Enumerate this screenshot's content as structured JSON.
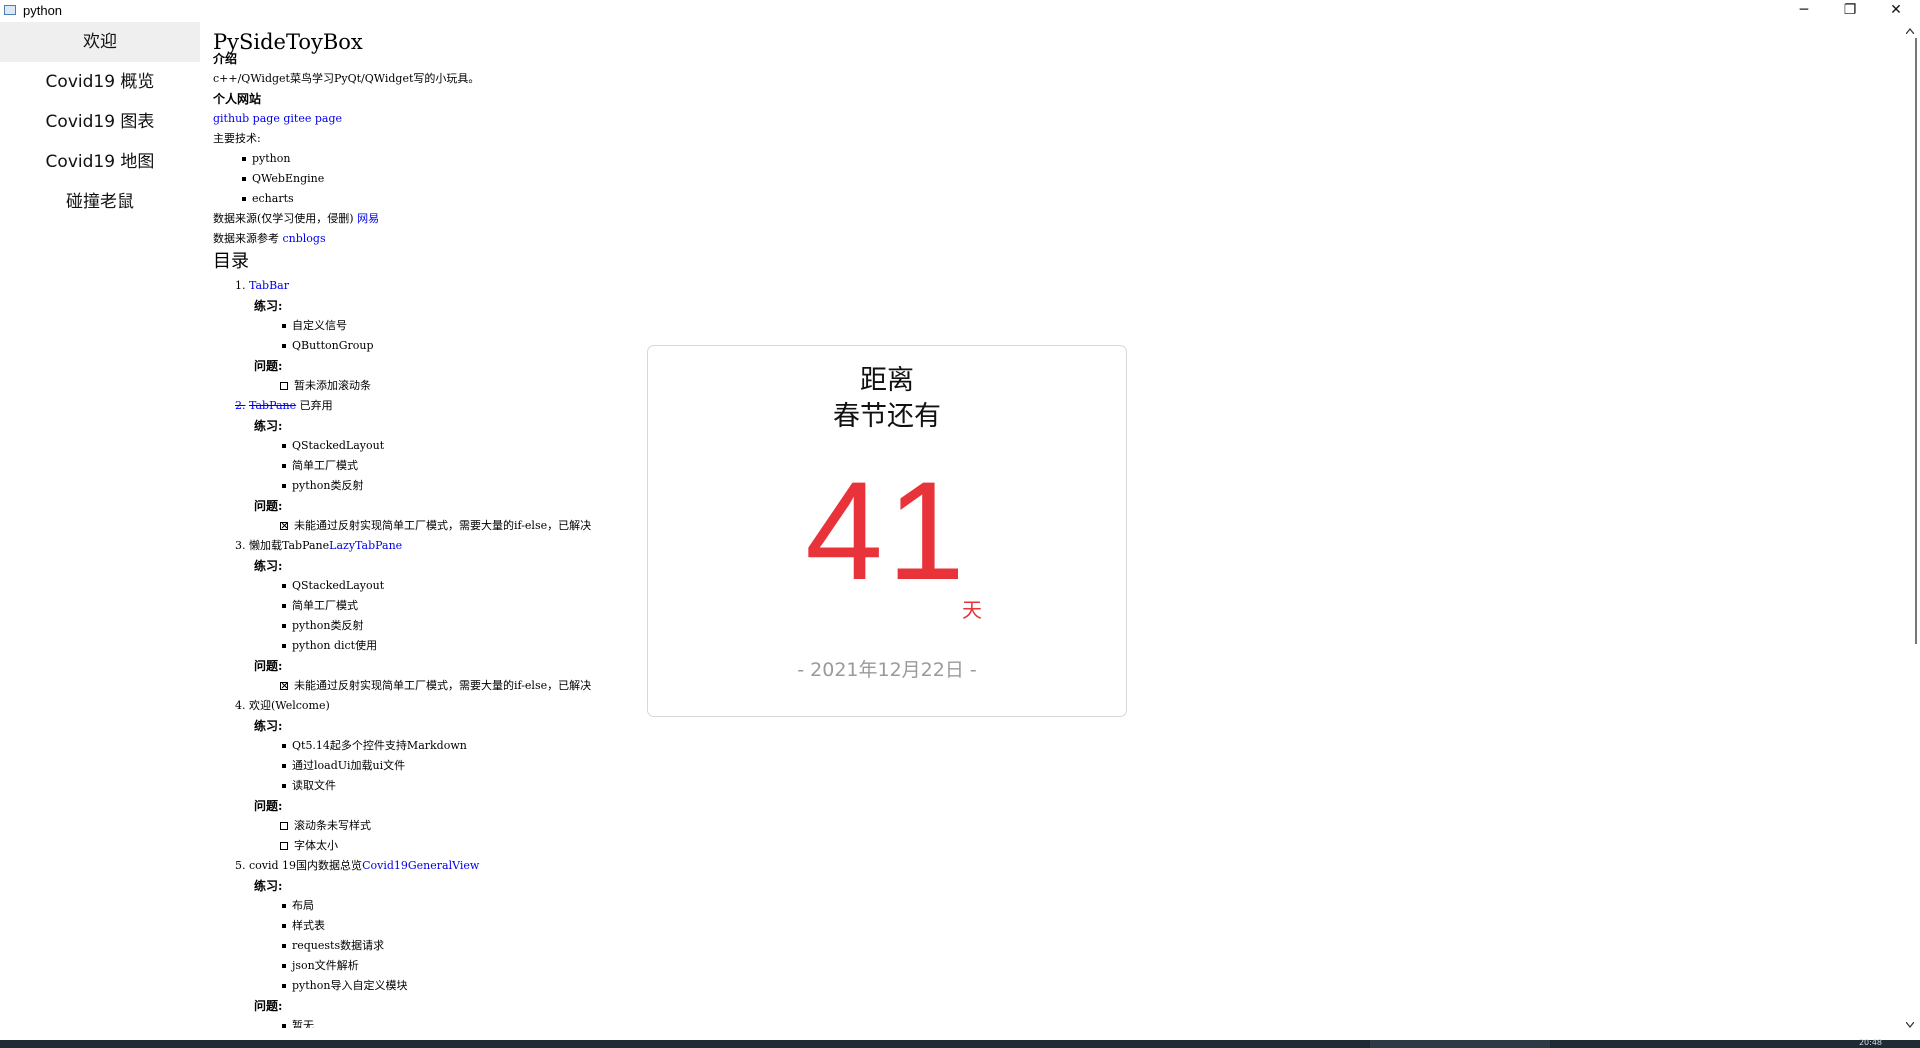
{
  "window": {
    "title": "python",
    "minimize_glyph": "─",
    "restore_glyph": "❐",
    "close_glyph": "✕"
  },
  "sidebar": {
    "items": [
      {
        "label": "欢迎"
      },
      {
        "label": "Covid19 概览"
      },
      {
        "label": "Covid19 图表"
      },
      {
        "label": "Covid19 地图"
      },
      {
        "label": "碰撞老鼠"
      }
    ]
  },
  "doc": {
    "title": "PySideToyBox",
    "intro_heading": "介绍",
    "intro_text": "c++/QWidget菜鸟学习PyQt/QWidget写的小玩具。",
    "site_heading": "个人网站",
    "link_github": "github page",
    "link_gitee": "gitee page",
    "tech_label": "主要技术:",
    "tech_items": [
      "python",
      "QWebEngine",
      "echarts"
    ],
    "source_text": "数据来源(仅学习使用，侵删)",
    "source_link": "网易",
    "ref_text": "数据来源参考",
    "ref_link": "cnblogs",
    "toc_heading": "目录",
    "practice_label": "练习:",
    "issue_label": "问题:",
    "sections": [
      {
        "num": "1.",
        "prefix": "",
        "link": "TabBar",
        "suffix": "",
        "practice": [
          "自定义信号",
          "QButtonGroup"
        ],
        "issues": [
          {
            "text": "暂未添加滚动条",
            "checked": false
          }
        ]
      },
      {
        "num": "2.",
        "prefix": "",
        "link": "TabPane",
        "suffix": "已弃用",
        "practice": [
          "QStackedLayout",
          "简单工厂模式",
          "python类反射"
        ],
        "issues": [
          {
            "text": "未能通过反射实现简单工厂模式，需要大量的if-else，已解决",
            "checked": true
          }
        ]
      },
      {
        "num": "3.",
        "prefix": "懒加载TabPane",
        "link": "LazyTabPane",
        "suffix": "",
        "practice": [
          "QStackedLayout",
          "简单工厂模式",
          "python类反射",
          "python dict使用"
        ],
        "issues": [
          {
            "text": "未能通过反射实现简单工厂模式，需要大量的if-else，已解决",
            "checked": true
          }
        ]
      },
      {
        "num": "4.",
        "prefix": "欢迎(Welcome)",
        "link": "",
        "suffix": "",
        "practice": [
          "Qt5.14起多个控件支持Markdown",
          "通过loadUi加载ui文件",
          "读取文件"
        ],
        "issues": [
          {
            "text": "滚动条未写样式",
            "checked": false
          },
          {
            "text": "字体太小",
            "checked": false
          }
        ]
      },
      {
        "num": "5.",
        "prefix": "covid 19国内数据总览",
        "link": "Covid19GeneralView",
        "suffix": "",
        "practice": [
          "布局",
          "样式表",
          "requests数据请求",
          "json文件解析",
          "python导入自定义模块"
        ],
        "issues_bullets": [
          "暂无"
        ]
      }
    ]
  },
  "countdown": {
    "line1": "距离",
    "line2": "春节还有",
    "days": "41",
    "unit": "天",
    "date": "- 2021年12月22日 -",
    "number_color": "#e8333b"
  },
  "taskbar": {
    "time": "20:48"
  }
}
